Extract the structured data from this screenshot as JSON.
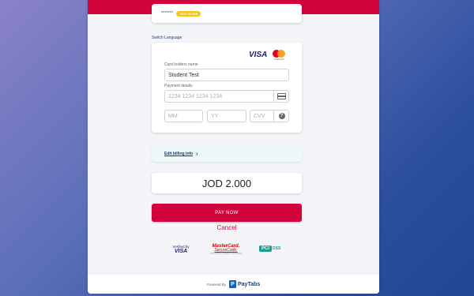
{
  "merchant": {
    "name": "*******",
    "mode_badge": "TEST MODE"
  },
  "switch_language": "Switch Language",
  "card_brands": {
    "visa": "VISA",
    "mastercard": "mastercard"
  },
  "form": {
    "cardholder_label": "Card holders name",
    "cardholder_value": "Student Test",
    "payment_label": "Payment details",
    "card_number_placeholder": "1234 1234 1234 1234",
    "month_placeholder": "MM",
    "year_placeholder": "YY",
    "cvv_placeholder": "CVV",
    "help_glyph": "?"
  },
  "billing": {
    "link_label": "Edit billing info",
    "chevron": "›"
  },
  "amount": "JOD 2.000",
  "pay_button": "PAY NOW",
  "cancel_link": "Cancel",
  "security_badges": {
    "vbv_line1": "Verified by",
    "vbv_line2": "VISA",
    "mcsc_line1": "MasterCard.",
    "mcsc_line2": "SecureCode.",
    "mcsc_line3": "PORTUNE LOADING PROVIDER",
    "pci_mark": "PCI",
    "pci_dss": "DSS"
  },
  "footer": {
    "powered_by": "Powered By",
    "brand_icon": "P",
    "brand_name": "PayTabs"
  },
  "colors": {
    "brand_red": "#d0043b",
    "text_dark": "#222222",
    "link_blue": "#123c7a"
  }
}
